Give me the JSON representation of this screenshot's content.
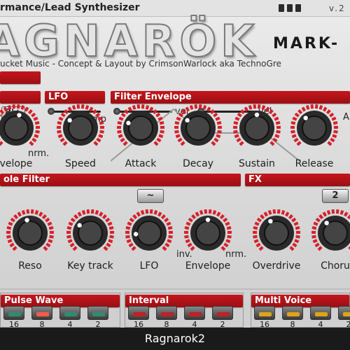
{
  "window": {
    "title": "rmance/Lead Synthesizer",
    "version": "v.2",
    "footer_title": "Ragnarok2"
  },
  "header": {
    "logo": "AGNARÖK",
    "mark": "MARK-",
    "credit": "ucket Music - Concept & Layout by CrimsonWarlock aka TechnoGre"
  },
  "sections": {
    "envelope": "",
    "lfo": "LFO",
    "filter_envelope": "Filter Envelope",
    "filter": "ole Filter",
    "fx": "FX",
    "pulse_wave": "Pulse Wave",
    "interval": "Interval",
    "multi_voice": "Multi Voice"
  },
  "top_controls": {
    "octave_button": "8'+",
    "rmp_label": "rmp",
    "vel_label_1": "vel",
    "vel_label_2": "vel",
    "a_label": "A",
    "nrm_label": "nrm."
  },
  "top_knobs": [
    {
      "label": "velope",
      "value": 0.55
    },
    {
      "label": "Speed",
      "value": 0.3
    },
    {
      "label": "Attack",
      "value": 0.25
    },
    {
      "label": "Decay",
      "value": 0.3
    },
    {
      "label": "Sustain",
      "value": 0.5
    },
    {
      "label": "Release",
      "value": 0.35
    }
  ],
  "mid_controls": {
    "wave_button": "~",
    "fx_button": "2",
    "inv_label": "inv.",
    "nrm_label": "nrm."
  },
  "mid_knobs": [
    {
      "label": "Reso",
      "value": 0.45
    },
    {
      "label": "Key track",
      "value": 0.3
    },
    {
      "label": "LFO",
      "value": 0.15
    },
    {
      "label": "Envelope",
      "value": 0.5
    },
    {
      "label": "Overdrive",
      "value": 0.4
    },
    {
      "label": "Choru",
      "value": 0.35
    }
  ],
  "pulse_wave": {
    "buttons": [
      {
        "label": "16",
        "active": false
      },
      {
        "label": "8",
        "active": true
      },
      {
        "label": "4",
        "active": false
      },
      {
        "label": "2",
        "active": false
      }
    ]
  },
  "interval": {
    "buttons": [
      {
        "label": "16",
        "active": false
      },
      {
        "label": "8",
        "active": false
      },
      {
        "label": "4",
        "active": false
      },
      {
        "label": "2",
        "active": false
      }
    ]
  },
  "multi_voice": {
    "buttons": [
      {
        "label": "16",
        "active": false
      },
      {
        "label": "8",
        "active": false
      },
      {
        "label": "4",
        "active": false
      },
      {
        "label": "2",
        "active": false
      }
    ]
  },
  "colors": {
    "accent_red": "#c4161c",
    "led_green": "#2f8c6f",
    "led_red_on": "#ff5a4a",
    "led_red": "#c0202a",
    "led_yellow": "#e0a21a"
  }
}
